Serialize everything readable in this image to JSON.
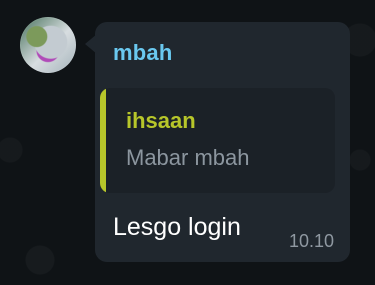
{
  "message": {
    "sender_name": "mbah",
    "reply": {
      "sender_name": "ihsaan",
      "text": "Mabar mbah"
    },
    "text": "Lesgo login",
    "timestamp": "10.10"
  },
  "colors": {
    "background": "#0f1316",
    "bubble": "#20272e",
    "sender": "#6ac8ef",
    "reply_accent": "#b7c62a"
  }
}
